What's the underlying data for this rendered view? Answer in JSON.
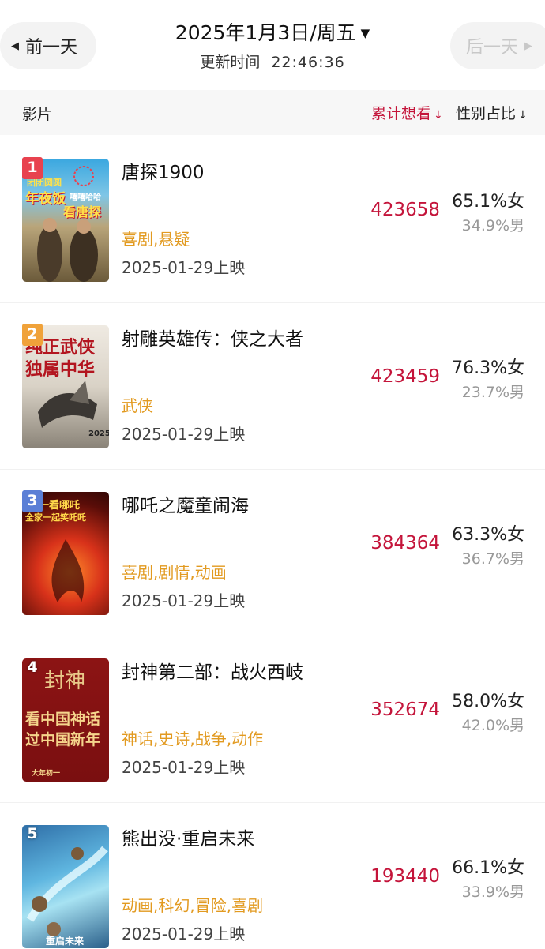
{
  "header": {
    "prev_label": "前一天",
    "next_label": "后一天",
    "date": "2025年1月3日/周五",
    "update_label": "更新时间",
    "update_time": "22:46:36"
  },
  "columns": {
    "film": "影片",
    "want": "累计想看",
    "gender": "性别占比"
  },
  "colors": {
    "accent": "#c4143a",
    "genre": "#e29a20",
    "rank1": "#e8424f",
    "rank2": "#f0a23a",
    "rank3": "#5b7fd6"
  },
  "movies": [
    {
      "rank": "1",
      "title": "唐探1900",
      "genre": "喜剧,悬疑",
      "release": "2025-01-29上映",
      "want": "423658",
      "female": "65.1%女",
      "male": "34.9%男",
      "poster_lines": [
        "团团圆圆",
        "年夜饭",
        "嘻嘻哈哈",
        "看唐探"
      ]
    },
    {
      "rank": "2",
      "title": "射雕英雄传：侠之大者",
      "genre": "武侠",
      "release": "2025-01-29上映",
      "want": "423459",
      "female": "76.3%女",
      "male": "23.7%男",
      "poster_lines": [
        "纯正武侠",
        "独属中华",
        "2025"
      ]
    },
    {
      "rank": "3",
      "title": "哪吒之魔童闹海",
      "genre": "喜剧,剧情,动画",
      "release": "2025-01-29上映",
      "want": "384364",
      "female": "63.3%女",
      "male": "36.7%男",
      "poster_lines": [
        "初一看哪吒",
        "全家一起笑吒吒"
      ]
    },
    {
      "rank": "4",
      "title": "封神第二部：战火西岐",
      "genre": "神话,史诗,战争,动作",
      "release": "2025-01-29上映",
      "want": "352674",
      "female": "58.0%女",
      "male": "42.0%男",
      "poster_lines": [
        "封神",
        "看中国神话",
        "过中国新年",
        "大年初一"
      ]
    },
    {
      "rank": "5",
      "title": "熊出没·重启未来",
      "genre": "动画,科幻,冒险,喜剧",
      "release": "2025-01-29上映",
      "want": "193440",
      "female": "66.1%女",
      "male": "33.9%男",
      "poster_lines": [
        "重启未来"
      ]
    }
  ]
}
